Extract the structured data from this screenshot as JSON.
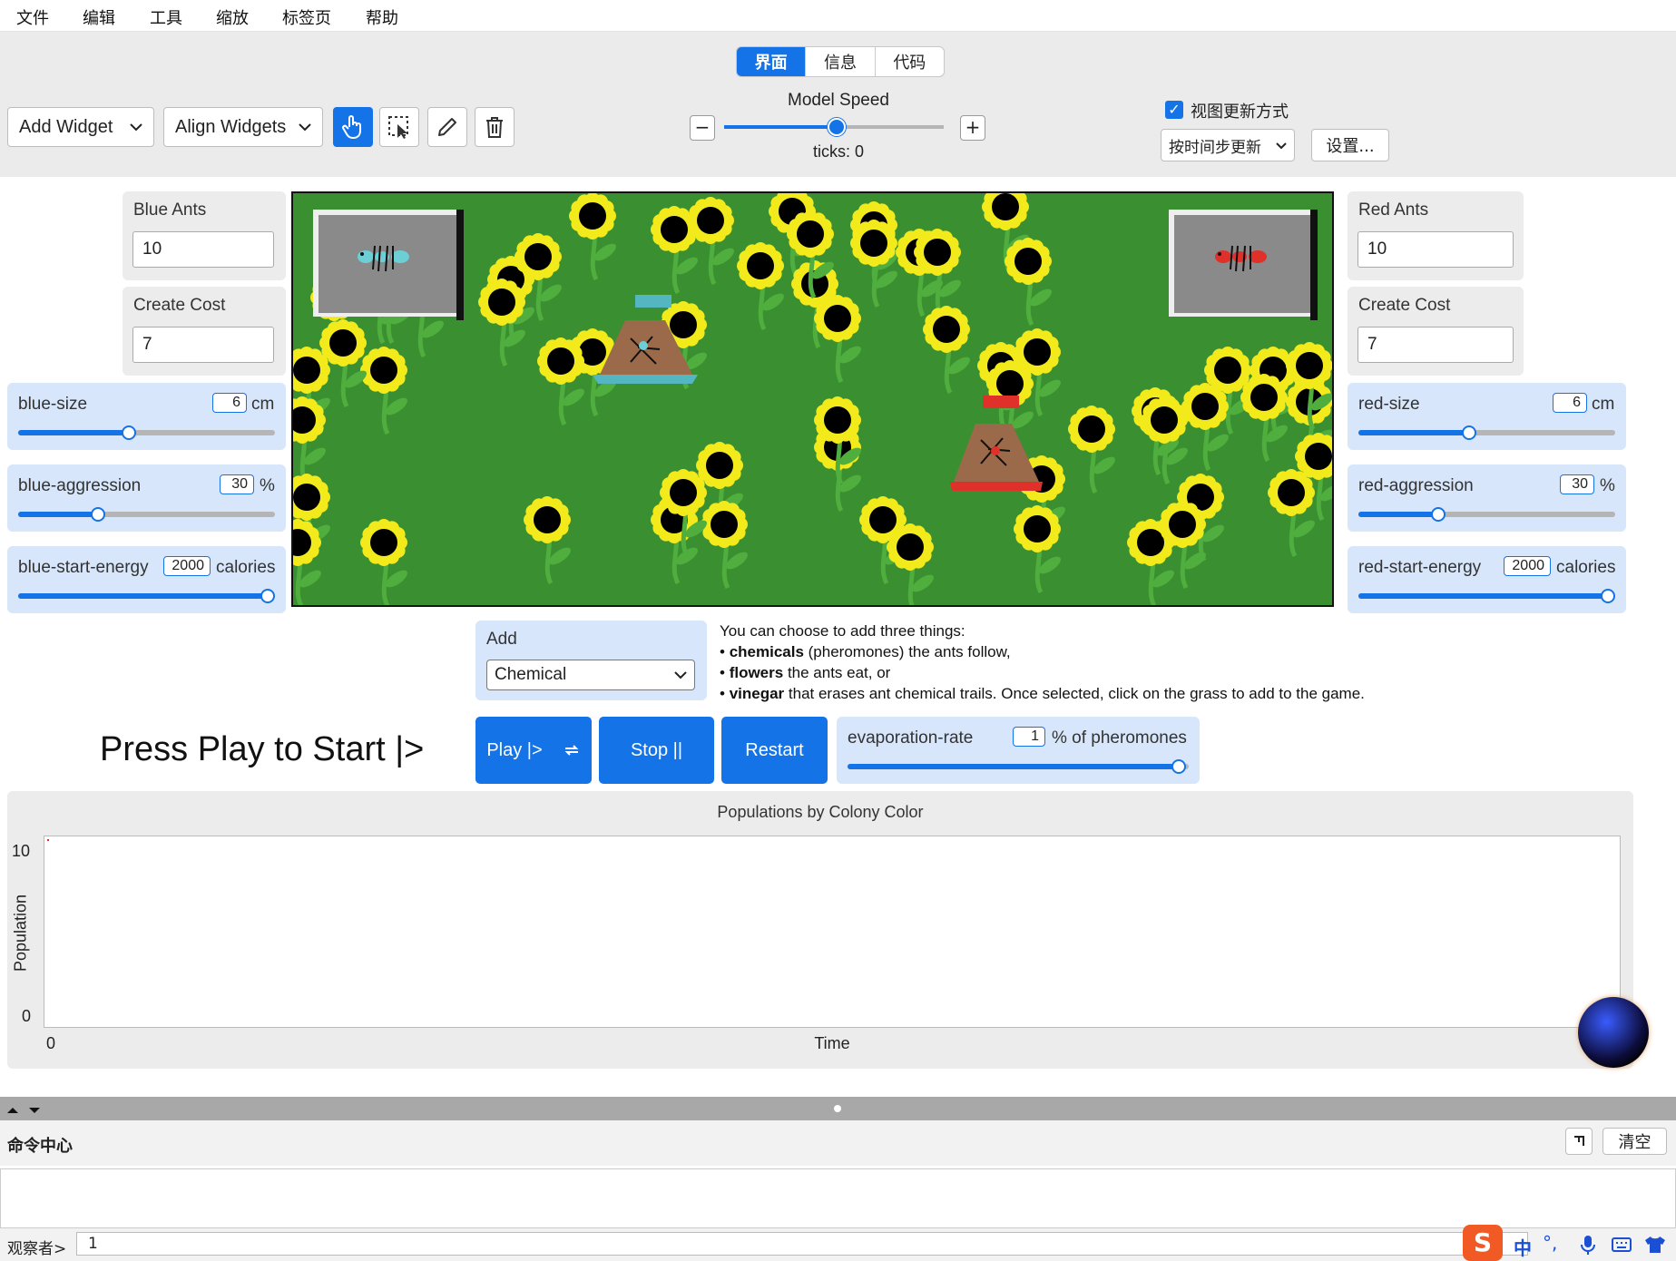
{
  "menu": [
    "文件",
    "编辑",
    "工具",
    "缩放",
    "标签页",
    "帮助"
  ],
  "tabs": [
    {
      "label": "界面",
      "active": true
    },
    {
      "label": "信息",
      "active": false
    },
    {
      "label": "代码",
      "active": false
    }
  ],
  "toolbar": {
    "add_widget": "Add Widget",
    "align_widgets": "Align Widgets",
    "speed_label": "Model Speed",
    "speed_minus": "−",
    "speed_plus": "+",
    "ticks": "ticks: 0",
    "view_update_label": "视图更新方式",
    "view_update_checked": true,
    "view_update_mode": "按时间步更新",
    "settings": "设置..."
  },
  "blue": {
    "ants_label": "Blue Ants",
    "ants_value": "10",
    "cost_label": "Create Cost",
    "cost_value": "7",
    "size": {
      "name": "blue-size",
      "value": "6",
      "unit": "cm",
      "fraction": 0.43
    },
    "aggression": {
      "name": "blue-aggression",
      "value": "30",
      "unit": "%",
      "fraction": 0.31
    },
    "energy": {
      "name": "blue-start-energy",
      "value": "2000",
      "unit": "calories",
      "fraction": 0.97
    }
  },
  "red": {
    "ants_label": "Red Ants",
    "ants_value": "10",
    "cost_label": "Create Cost",
    "cost_value": "7",
    "size": {
      "name": "red-size",
      "value": "6",
      "unit": "cm",
      "fraction": 0.43
    },
    "aggression": {
      "name": "red-aggression",
      "value": "30",
      "unit": "%",
      "fraction": 0.31
    },
    "energy": {
      "name": "red-start-energy",
      "value": "2000",
      "unit": "calories",
      "fraction": 0.97
    }
  },
  "add": {
    "label": "Add",
    "selected": "Chemical"
  },
  "help": {
    "intro": "You can choose to add three things:",
    "line1_bold": "chemicals",
    "line1_rest": " (pheromones) the ants follow,",
    "line2_bold": "flowers",
    "line2_rest": " the ants eat, or",
    "line3_bold": "vinegar",
    "line3_rest": " that erases ant chemical trails. Once selected, click on the grass to add to the game."
  },
  "press_play": "Press Play to Start |>",
  "buttons": {
    "play": "Play |>",
    "stop": "Stop ||",
    "restart": "Restart"
  },
  "evaporation": {
    "name": "evaporation-rate",
    "value": "1",
    "unit": "% of pheromones",
    "fraction": 0.97
  },
  "plot": {
    "title": "Populations by Colony Color",
    "ylabel": "Population",
    "xlabel": "Time",
    "y_max": "10",
    "y_min": "0",
    "x_min": "0"
  },
  "command": {
    "title": "命令中心",
    "clear": "清空",
    "prompt": "观察者>",
    "input": "1"
  },
  "colors": {
    "accent": "#1473e6",
    "grass": "#3a8f30",
    "blue_ant": "#6ccfd6",
    "red_ant": "#e0302a"
  }
}
